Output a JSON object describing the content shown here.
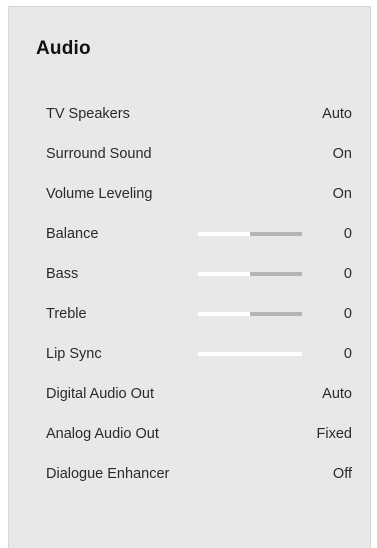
{
  "title": "Audio",
  "colors": {
    "panel_bg": "#e8e8e8",
    "text": "#2a2a2a",
    "slider_filled": "#ffffff",
    "slider_track": "#b5b5b5"
  },
  "items": [
    {
      "label": "TV Speakers",
      "value": "Auto"
    },
    {
      "label": "Surround Sound",
      "value": "On"
    },
    {
      "label": "Volume Leveling",
      "value": "On"
    },
    {
      "label": "Balance",
      "value": "0",
      "slider_level": 0.5
    },
    {
      "label": "Bass",
      "value": "0",
      "slider_level": 0.5
    },
    {
      "label": "Treble",
      "value": "0",
      "slider_level": 0.5
    },
    {
      "label": "Lip Sync",
      "value": "0",
      "slider_level": 1.0
    },
    {
      "label": "Digital Audio Out",
      "value": "Auto"
    },
    {
      "label": "Analog Audio Out",
      "value": "Fixed"
    },
    {
      "label": "Dialogue Enhancer",
      "value": "Off"
    }
  ]
}
